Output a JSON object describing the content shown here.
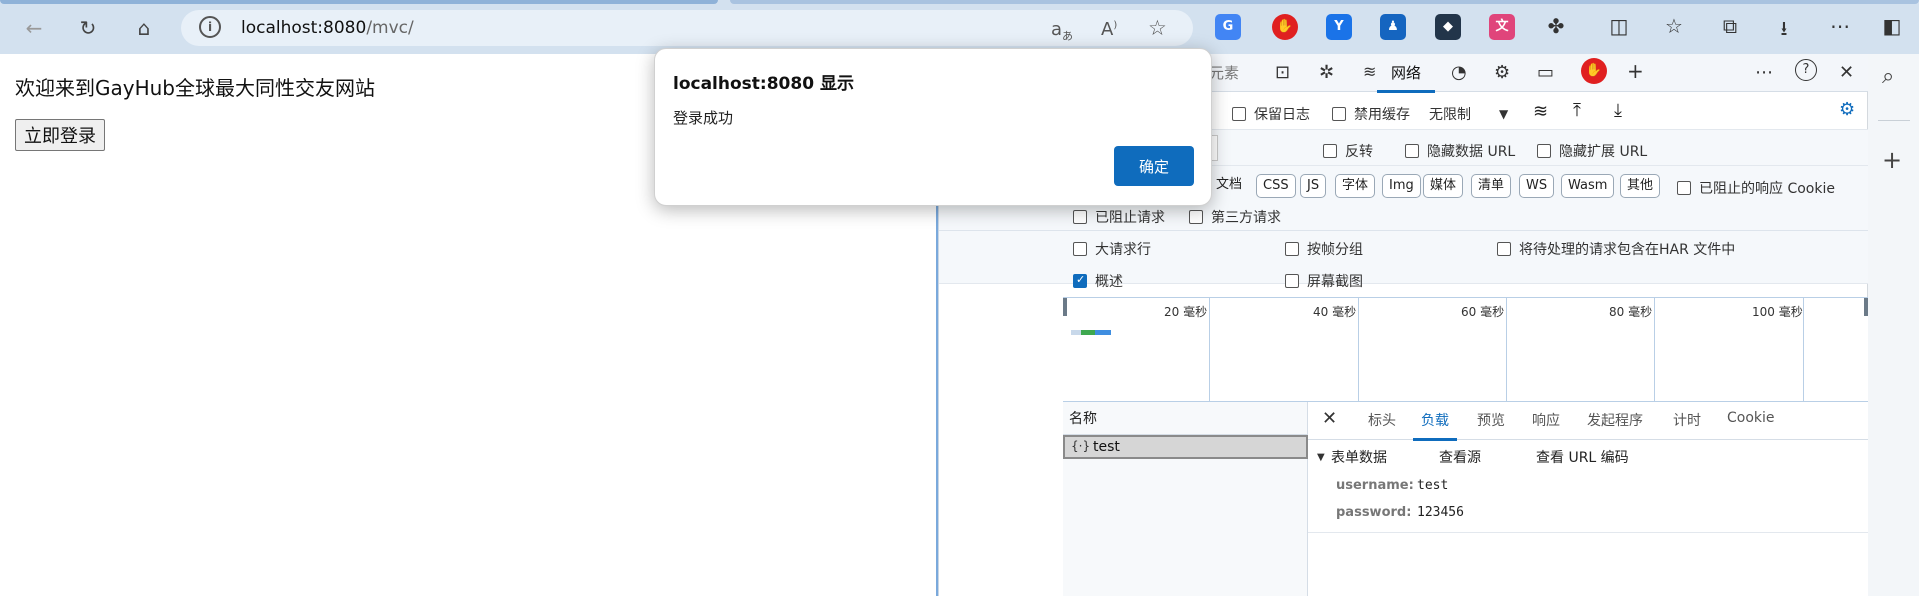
{
  "browser": {
    "url_host": "localhost:8080",
    "url_path": "/mvc/",
    "info_icon": "info-icon",
    "address_icons": [
      "read-aloud-icon",
      "immersive-reader-icon",
      "favorite-star-icon"
    ],
    "extensions": [
      {
        "name": "google-translate-extension-icon",
        "text": "G",
        "color": "#4285f4"
      },
      {
        "name": "adblock-extension-icon",
        "text": "✋",
        "color": "#e02020"
      },
      {
        "name": "blue-extension-icon",
        "text": "Y",
        "color": "#1a73e8"
      },
      {
        "name": "person-extension-icon",
        "text": "♟",
        "color": "#1565c0"
      },
      {
        "name": "dark-extension-icon",
        "text": "◆",
        "color": "#22354a"
      },
      {
        "name": "translate-extension-icon",
        "text": "文",
        "color": "#e0457b"
      }
    ]
  },
  "page": {
    "welcome_text": "欢迎来到GayHub全球最大同性交友网站",
    "login_button": "立即登录"
  },
  "dialog": {
    "title": "localhost:8080 显示",
    "message": "登录成功",
    "ok_button": "确定"
  },
  "devtools": {
    "tabs": [
      "元素",
      "网络"
    ],
    "filter_row1": {
      "preserve_log": "保留日志",
      "disable_cache": "禁用缓存",
      "throttle": "无限制"
    },
    "filter_row2": {
      "invert": "反转",
      "hide_data_url": "隐藏数据 URL",
      "hide_ext_url": "隐藏扩展 URL"
    },
    "type_chips": [
      "文档",
      "CSS",
      "JS",
      "字体",
      "Img",
      "媒体",
      "清单",
      "WS",
      "Wasm",
      "其他"
    ],
    "blocked_cookies": "已阻止的响应 Cookie",
    "blocked_requests": "已阻止请求",
    "third_party": "第三方请求",
    "big_rows": "大请求行",
    "group_by_frame": "按帧分组",
    "include_pending_har": "将待处理的请求包含在HAR 文件中",
    "overview": "概述",
    "screenshots": "屏幕截图",
    "timeline_labels": [
      "20 毫秒",
      "40 毫秒",
      "60 毫秒",
      "80 毫秒",
      "100 毫秒"
    ],
    "name_header": "名称",
    "request_name": "test",
    "panel_tabs": [
      "标头",
      "负载",
      "预览",
      "响应",
      "发起程序",
      "计时",
      "Cookie"
    ],
    "form_section": "表单数据",
    "view_source": "查看源",
    "view_url_encoded": "查看 URL 编码",
    "fields": [
      {
        "key": "username:",
        "value": "test"
      },
      {
        "key": "password:",
        "value": "123456"
      }
    ]
  }
}
